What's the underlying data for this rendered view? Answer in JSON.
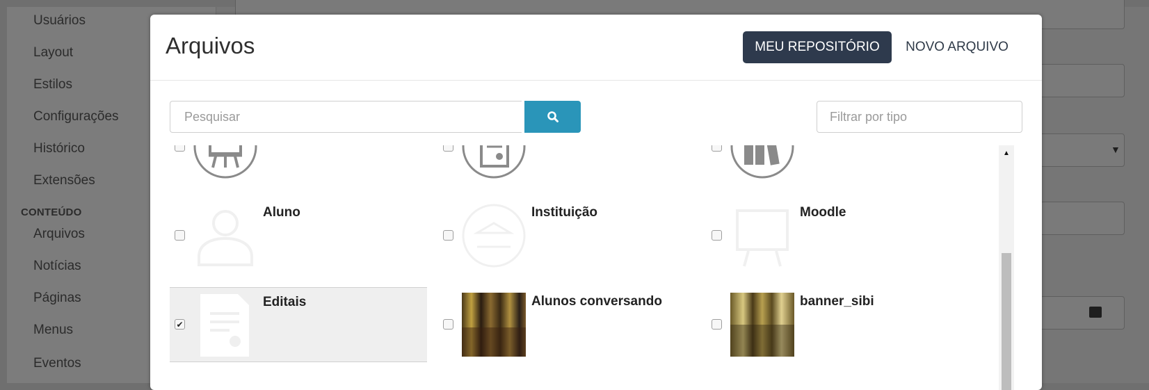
{
  "sidebar": {
    "items": [
      {
        "label": "Usuários"
      },
      {
        "label": "Layout"
      },
      {
        "label": "Estilos"
      },
      {
        "label": "Configurações"
      },
      {
        "label": "Histórico"
      },
      {
        "label": "Extensões"
      }
    ],
    "section_label": "CONTEÚDO",
    "content_items": [
      {
        "label": "Arquivos"
      },
      {
        "label": "Notícias"
      },
      {
        "label": "Páginas"
      },
      {
        "label": "Menus"
      },
      {
        "label": "Eventos"
      }
    ]
  },
  "modal": {
    "title": "Arquivos",
    "tabs": [
      {
        "label": "MEU REPOSITÓRIO",
        "active": true
      },
      {
        "label": "NOVO ARQUIVO",
        "active": false
      }
    ],
    "search": {
      "placeholder": "Pesquisar",
      "value": ""
    },
    "filter": {
      "placeholder": "Filtrar por tipo",
      "value": ""
    },
    "files": [
      {
        "name": "Aluno",
        "icon": "student-icon",
        "checked": false
      },
      {
        "name": "Instituição",
        "icon": "institution-icon",
        "checked": false
      },
      {
        "name": "Moodle",
        "icon": "easel-icon",
        "checked": false
      },
      {
        "name": "Editais",
        "icon": "document-icon",
        "checked": true
      },
      {
        "name": "Alunos conversando",
        "icon": "photo-thumbnail",
        "checked": false
      },
      {
        "name": "banner_sibi",
        "icon": "photo-thumbnail",
        "checked": false
      }
    ]
  },
  "colors": {
    "primary_tab": "#2e3a4d",
    "search_button": "#2a95b9",
    "icon_gray": "#8a8a8a"
  }
}
